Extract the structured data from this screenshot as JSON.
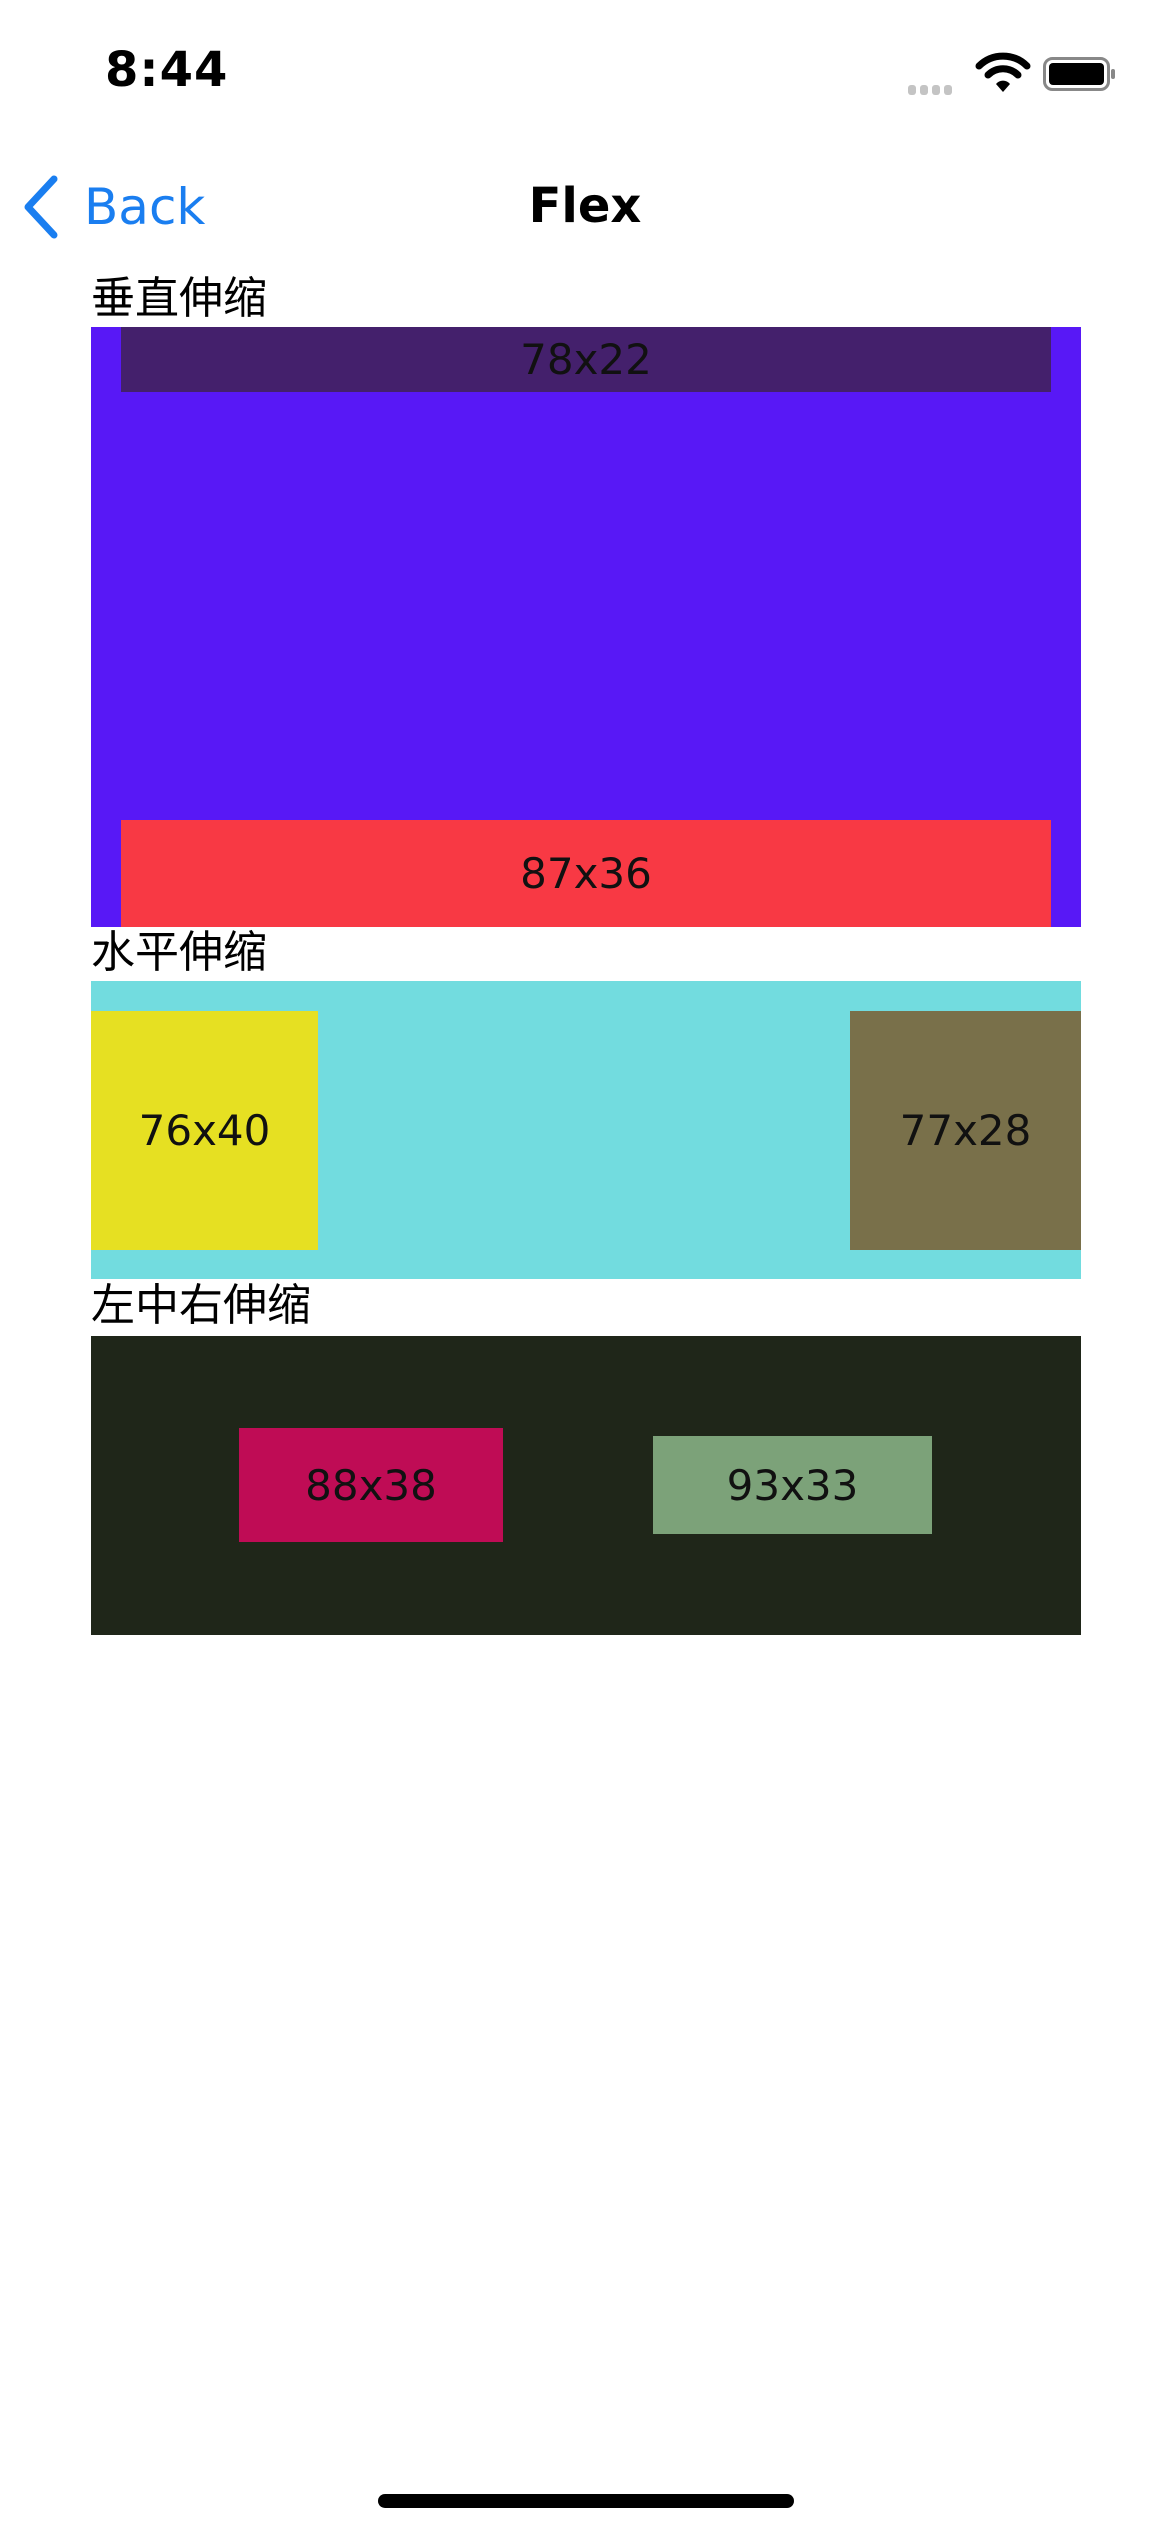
{
  "status_bar": {
    "time": "8:44",
    "icons": [
      "cellular-signal-icon",
      "wifi-icon",
      "battery-icon"
    ]
  },
  "nav": {
    "back_label": "Back",
    "title": "Flex",
    "accent_color": "#1a7ef0"
  },
  "sections": [
    {
      "label": "垂直伸缩",
      "container_color": "#5818f6",
      "items": [
        {
          "label": "78x22",
          "color": "#44206c"
        },
        {
          "label": "87x36",
          "color": "#f83944"
        }
      ]
    },
    {
      "label": "水平伸缩",
      "container_color": "#72dcdf",
      "items": [
        {
          "label": "76x40",
          "color": "#e6e022"
        },
        {
          "label": "77x28",
          "color": "#79704a"
        }
      ]
    },
    {
      "label": "左中右伸缩",
      "container_color": "#1f2619",
      "items": [
        {
          "label": "88x38",
          "color": "#bf0c55"
        },
        {
          "label": "93x33",
          "color": "#7ca279"
        }
      ]
    }
  ]
}
